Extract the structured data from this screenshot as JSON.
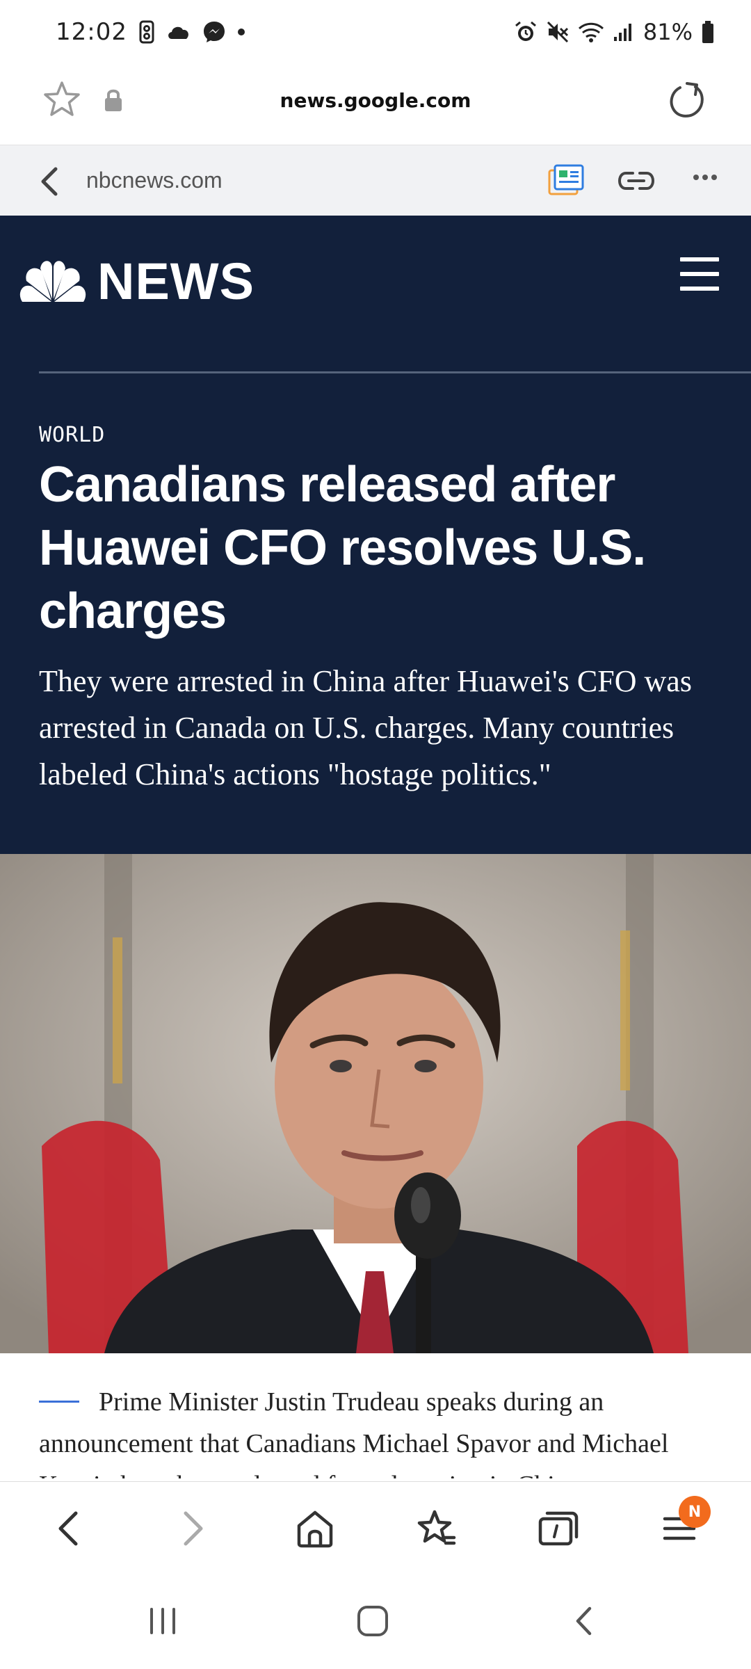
{
  "status_bar": {
    "time": "12:02",
    "battery_percent": "81%"
  },
  "url_bar": {
    "url": "news.google.com"
  },
  "source_bar": {
    "domain": "nbcnews.com"
  },
  "header": {
    "brand": "NEWS"
  },
  "article": {
    "section": "WORLD",
    "headline": "Canadians released after Huawei CFO resolves U.S. charges",
    "dek": "They were arrested in China after Huawei's CFO was arrested in Canada on U.S. charges. Many countries labeled China's actions \"hostage politics.\"",
    "caption": "Prime Minister Justin Trudeau speaks during an announcement that Canadians Michael Spavor and Michael Kovrig have been released from detention in China."
  },
  "bottom_toolbar": {
    "menu_badge": "N"
  },
  "colors": {
    "header_bg": "#12203b",
    "badge": "#f26b1d",
    "caption_accent": "#3a6fd8"
  }
}
